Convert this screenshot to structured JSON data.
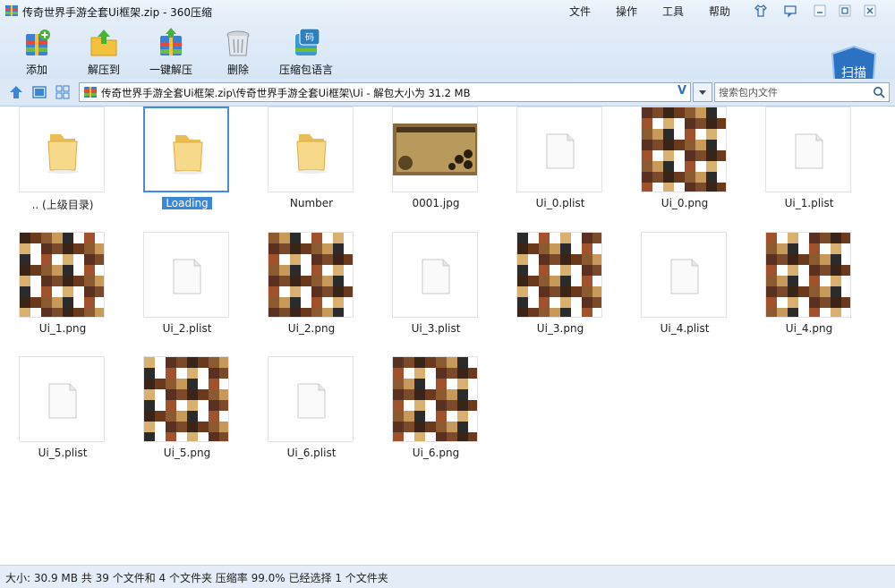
{
  "window": {
    "title": "传奇世界手游全套Ui框架.zip - 360压缩"
  },
  "menu": [
    "文件",
    "操作",
    "工具",
    "帮助"
  ],
  "toolbar": [
    {
      "label": "添加",
      "icon": "add-archive-icon"
    },
    {
      "label": "解压到",
      "icon": "extract-to-icon"
    },
    {
      "label": "一键解压",
      "icon": "one-click-extract-icon"
    },
    {
      "label": "删除",
      "icon": "delete-icon"
    },
    {
      "label": "压缩包语言",
      "icon": "archive-language-icon"
    }
  ],
  "scan": {
    "label": "扫描"
  },
  "address": {
    "path": "传奇世界手游全套Ui框架.zip\\传奇世界手游全套Ui框架\\Ui - 解包大小为 31.2 MB",
    "dropdown_glyph": "V"
  },
  "search": {
    "placeholder": "搜索包内文件"
  },
  "items": [
    {
      "name": ".. (上级目录)",
      "kind": "folder"
    },
    {
      "name": "Loading",
      "kind": "folder",
      "selected": true
    },
    {
      "name": "Number",
      "kind": "folder"
    },
    {
      "name": "0001.jpg",
      "kind": "game-jpg"
    },
    {
      "name": "Ui_0.plist",
      "kind": "file"
    },
    {
      "name": "Ui_0.png",
      "kind": "png"
    },
    {
      "name": "Ui_1.plist",
      "kind": "file"
    },
    {
      "name": "Ui_1.png",
      "kind": "png"
    },
    {
      "name": "Ui_2.plist",
      "kind": "file"
    },
    {
      "name": "Ui_2.png",
      "kind": "png"
    },
    {
      "name": "Ui_3.plist",
      "kind": "file"
    },
    {
      "name": "Ui_3.png",
      "kind": "png"
    },
    {
      "name": "Ui_4.plist",
      "kind": "file"
    },
    {
      "name": "Ui_4.png",
      "kind": "png"
    },
    {
      "name": "Ui_5.plist",
      "kind": "file"
    },
    {
      "name": "Ui_5.png",
      "kind": "png"
    },
    {
      "name": "Ui_6.plist",
      "kind": "file"
    },
    {
      "name": "Ui_6.png",
      "kind": "png"
    }
  ],
  "status": {
    "text": "大小: 30.9 MB 共 39 个文件和 4 个文件夹 压缩率 99.0% 已经选择 1 个文件夹"
  },
  "colors": {
    "accent": "#3b87d8",
    "toolbar": "#dce8f5",
    "folder": "#f3d27a"
  }
}
